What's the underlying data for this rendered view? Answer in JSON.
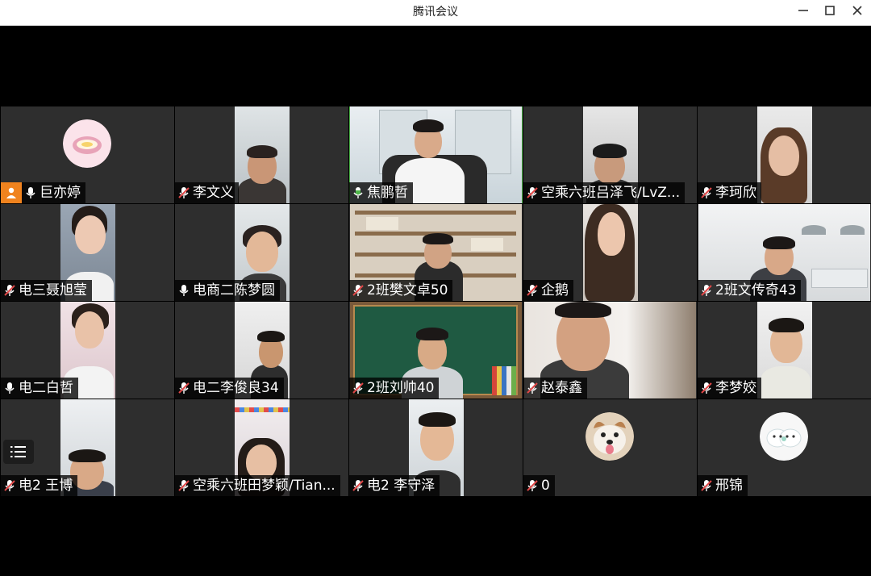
{
  "window": {
    "title": "腾讯会议",
    "minimize_glyph": "—",
    "maximize_glyph": "☐",
    "close_glyph": "✕"
  },
  "colors": {
    "titlebar_bg": "#ffffff",
    "tile_bg": "#2e2e2e",
    "stage_bg": "#000000",
    "active_speaker_border": "#4fb54a",
    "host_badge": "#f0831e",
    "muted_mic": "#e04848",
    "unmuted_mic": "#ffffff"
  },
  "participants": [
    {
      "name": "巨亦婷",
      "mic": "on",
      "host": true,
      "video": false,
      "avatar": "lips-avatar"
    },
    {
      "name": "李文义",
      "mic": "muted",
      "video": true
    },
    {
      "name": "焦鹏哲",
      "mic": "on",
      "video": true,
      "active": true
    },
    {
      "name": "空乘六班吕泽飞/LvZ...",
      "mic": "muted",
      "video": true
    },
    {
      "name": "李珂欣",
      "mic": "muted",
      "video": true
    },
    {
      "name": "电三聂旭莹",
      "mic": "muted",
      "video": true
    },
    {
      "name": "电商二陈梦圆",
      "mic": "on",
      "video": true
    },
    {
      "name": "2班樊文卓50",
      "mic": "muted",
      "video": true
    },
    {
      "name": "企鹅",
      "mic": "muted",
      "video": true
    },
    {
      "name": "2班文传奇43",
      "mic": "muted",
      "video": true
    },
    {
      "name": "电二白哲",
      "mic": "on",
      "video": true
    },
    {
      "name": "电二李俊良34",
      "mic": "muted",
      "video": true
    },
    {
      "name": "2班刘帅40",
      "mic": "muted",
      "video": true
    },
    {
      "name": "赵泰鑫",
      "mic": "muted",
      "video": true
    },
    {
      "name": "李梦姣",
      "mic": "muted",
      "video": true
    },
    {
      "name": "电2 王博",
      "mic": "muted",
      "video": true
    },
    {
      "name": "空乘六班田梦颖/Tian...",
      "mic": "muted",
      "video": true
    },
    {
      "name": "电2 李守泽",
      "mic": "muted",
      "video": true
    },
    {
      "name": "0",
      "mic": "muted",
      "video": false,
      "avatar": "dog-avatar"
    },
    {
      "name": "邢锦",
      "mic": "muted",
      "video": false,
      "avatar": "cartoon-avatar"
    }
  ]
}
